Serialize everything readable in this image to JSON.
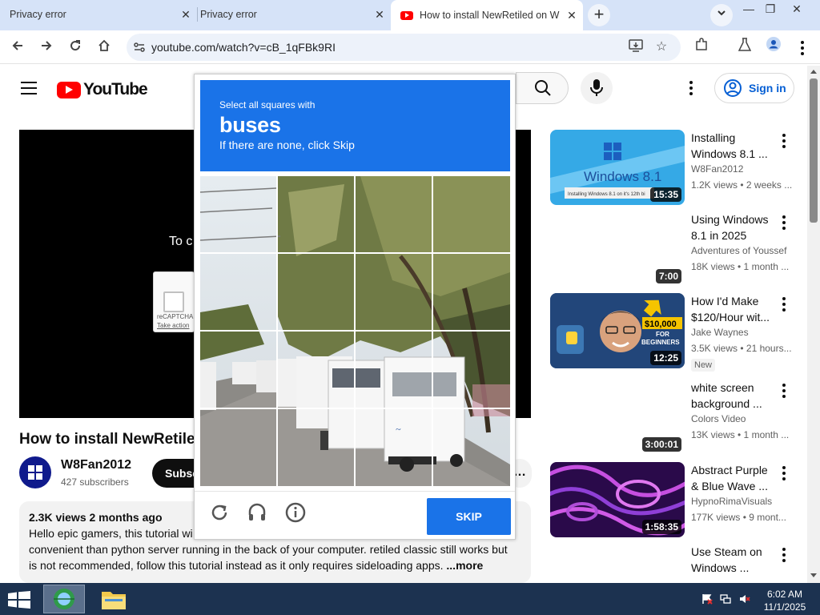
{
  "browser": {
    "tabs": [
      {
        "title": "Privacy error"
      },
      {
        "title": "Privacy error"
      },
      {
        "title": "How to install NewRetiled on W"
      }
    ],
    "url": "youtube.com/watch?v=cB_1qFBk9RI"
  },
  "youtube": {
    "logo_text": "YouTube",
    "sign_in": "Sign in",
    "player_message": "To c",
    "mini_captcha": {
      "line1": "reCAPTCHA",
      "line2": "Take action"
    },
    "video": {
      "title": "How to install NewRetile",
      "channel": "W8Fan2012",
      "subscribers": "427 subscribers",
      "subscribe_label": "Subsc",
      "more_actions": "…",
      "views_date": "2.3K views  2 months ago",
      "description_line1": "Hello epic gamers, this tutorial wi",
      "description_line2": "convenient than python server running in the back of your computer. retiled classic still works but",
      "description_line3": "is not recommended, follow this tutorial instead as it only requires sideloading apps.",
      "more_label": "...more"
    },
    "recommendations": [
      {
        "title_l1": "Installing",
        "title_l2": "Windows 8.1 ...",
        "channel": "W8Fan2012",
        "stats": "1.2K views • 2 weeks ...",
        "duration": "15:35",
        "thumb_text": "Windows 8.1",
        "thumb_caption": "Installing Windows 8.1 on it's 12th bi"
      },
      {
        "title_l1": "Using Windows",
        "title_l2": "8.1 in 2025",
        "channel": "Adventures of Youssef",
        "stats": "18K views • 1 month ...",
        "duration": "7:00"
      },
      {
        "title_l1": "How I'd Make",
        "title_l2": "$120/Hour wit...",
        "channel": "Jake Waynes",
        "stats": "3.5K views • 21 hours...",
        "duration": "12:25",
        "badge": "New",
        "thumb_money": "$10,000",
        "thumb_for": "FOR",
        "thumb_beginners": "BEGINNERS"
      },
      {
        "title_l1": "white screen",
        "title_l2": "background ...",
        "channel": "Colors Video",
        "stats": "13K views • 1 month ...",
        "duration": "3:00:01"
      },
      {
        "title_l1": "Abstract Purple",
        "title_l2": "& Blue Wave ...",
        "channel": "HypnoRimaVisuals",
        "stats": "177K views • 9 mont...",
        "duration": "1:58:35"
      },
      {
        "title_l1": "Use Steam on",
        "title_l2": "Windows ..."
      }
    ]
  },
  "captcha": {
    "instruction": "Select all squares with",
    "target": "buses",
    "hint": "If there are none, click Skip",
    "skip_label": "SKIP",
    "accent": "#1a73e8"
  },
  "taskbar": {
    "time": "6:02 AM",
    "date": "11/1/2025"
  }
}
